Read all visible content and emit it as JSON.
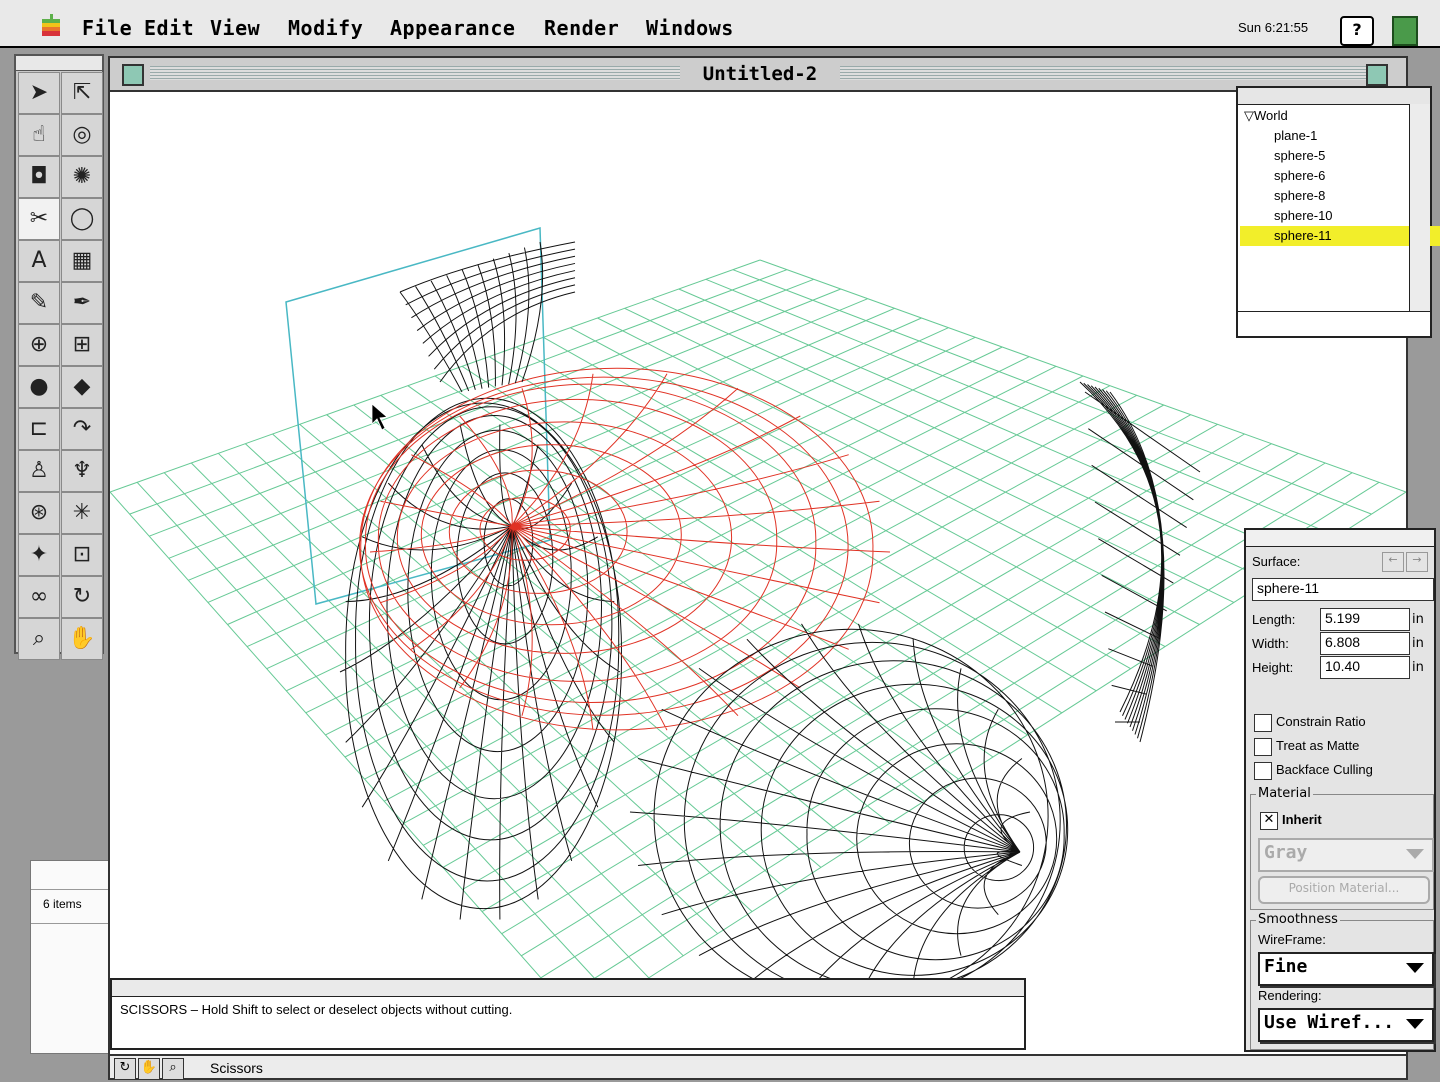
{
  "menubar": {
    "items": [
      "File",
      "Edit",
      "View",
      "Modify",
      "Appearance",
      "Render",
      "Windows"
    ],
    "clock": "Sun 6:21:55",
    "help_icon": "?"
  },
  "document": {
    "title": "Untitled-2"
  },
  "scene_list": {
    "root": "World",
    "items": [
      "plane-1",
      "sphere-5",
      "sphere-6",
      "sphere-8",
      "sphere-10",
      "sphere-11"
    ],
    "selected": "sphere-11",
    "highlight_color": "#f2ee2a"
  },
  "properties": {
    "surface_label": "Surface:",
    "surface_value": "sphere-11",
    "length_label": "Length:",
    "length_value": "5.199",
    "width_label": "Width:",
    "width_value": "6.808",
    "height_label": "Height:",
    "height_value": "10.40",
    "unit": "in",
    "checks": [
      {
        "label": "Constrain Ratio",
        "checked": false
      },
      {
        "label": "Treat as Matte",
        "checked": false
      },
      {
        "label": "Backface Culling",
        "checked": false
      }
    ],
    "material_group": "Material",
    "inherit_label": "Inherit",
    "inherit_checked": true,
    "material_value": "Gray",
    "position_material_label": "Position Material...",
    "smoothness_group": "Smoothness",
    "wireframe_label": "WireFrame:",
    "wireframe_value": "Fine",
    "rendering_label": "Rendering:",
    "rendering_value": "Use Wiref..."
  },
  "help_bar": {
    "text": "SCISSORS – Hold Shift to select or deselect objects without cutting."
  },
  "status_bar": {
    "tool": "Scissors"
  },
  "finder": {
    "count": "6 items"
  },
  "tools": [
    "arrow-icon",
    "direct-select-icon",
    "hand-rotate-icon",
    "target-icon",
    "camera-icon",
    "light-icon",
    "scissors-icon",
    "sphere-outline-icon",
    "text-icon",
    "plane-grid-icon",
    "pencil-icon",
    "pen-icon",
    "crosshair-icon",
    "grid-icon",
    "sphere-icon",
    "cube-icon",
    "extrude-icon",
    "sweep-icon",
    "lathe-icon",
    "skin-icon",
    "mesh-icon",
    "burst-icon",
    "magic-icon",
    "frame-icon",
    "glasses-icon",
    "rotate-icon",
    "zoom-icon",
    "hand-icon"
  ],
  "colors": {
    "grid": "#4bbf82",
    "selected_wire": "#e03224",
    "wire": "#111111",
    "cut_plane": "#49b8c4"
  }
}
